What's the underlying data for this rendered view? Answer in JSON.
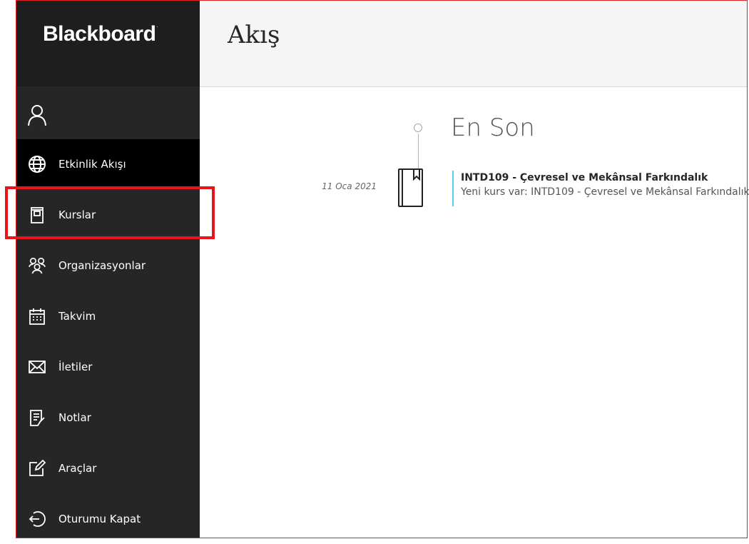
{
  "brand": {
    "name": "Blackboard",
    "mark": "."
  },
  "sidebar": {
    "items": [
      {
        "label": "Etkinlik Akışı",
        "icon": "globe-icon"
      },
      {
        "label": "Kurslar",
        "icon": "course-book-icon"
      },
      {
        "label": "Organizasyonlar",
        "icon": "organizations-icon"
      },
      {
        "label": "Takvim",
        "icon": "calendar-icon"
      },
      {
        "label": "İletiler",
        "icon": "envelope-icon"
      },
      {
        "label": "Notlar",
        "icon": "grades-icon"
      },
      {
        "label": "Araçlar",
        "icon": "tools-icon"
      },
      {
        "label": "Oturumu Kapat",
        "icon": "logout-icon"
      }
    ]
  },
  "header": {
    "title": "Akış"
  },
  "stream": {
    "section_title": "En Son",
    "items": [
      {
        "date": "11 Oca 2021",
        "title": "INTD109 - Çevresel ve Mekânsal Farkındalık",
        "subtitle": "Yeni kurs var: INTD109 - Çevresel ve Mekânsal Farkındalık"
      }
    ]
  },
  "colors": {
    "sidebar_bg": "#262626",
    "active_bg": "#000000",
    "highlight": "#e8141a",
    "accent": "#5bc6e8"
  }
}
